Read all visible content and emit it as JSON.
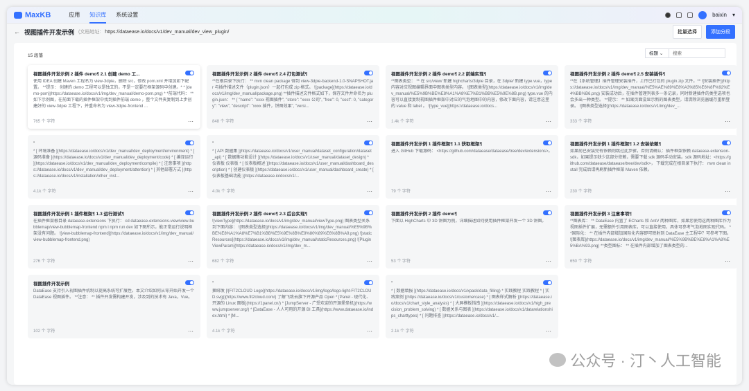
{
  "header": {
    "logo": "MaxKB",
    "nav": [
      "应用",
      "知识库",
      "系统设置"
    ],
    "active_nav": 1,
    "user": "baixin"
  },
  "subheader": {
    "back": "←",
    "title": "视图插件开发示例",
    "doc_label": "(文档地址:",
    "doc_url": "https://dataease.io/docs/v1/dev_manual/dev_view_plugin/",
    "batch_select": "批量选择",
    "add_paragraph": "添加分段"
  },
  "list": {
    "count": "15 段落",
    "filter_select": "标题",
    "search_placeholder": "搜索"
  },
  "cards": [
    {
      "title": "视图插件开发示例 2 插件 demo¶ 2.1 创建 demo 工...",
      "content": "使用 IDEA 创建 Maven 工程名为 view-3dpie，删除 src，修改 pom.xml 并增加如下配置。 **提示： 创建的 demo 工程可以是独立的，不是一定要在框架源码中创建。* * [demo-pom](https://dataease.io/docs/v1/img/dev_manual/demo-pom.png) * *前端代码： ** 如下示例图，在前面下载的插件框架中找到插件前端 demo ，整个文件夹复制到上步创建好的 view-3dpie 工程下，并重命名为 view-3dpie-frontend ...",
      "chars": "765 个 字符",
      "enabled": true
    },
    {
      "title": "视图插件开发示例 2 插件 demo¶ 2.4 打包测试¶",
      "content": "**在根目录下执行： ** mvn clean package 得到 view-3dpie-backend-1.0-SNAPSHOT.jar 与插件描述文件（plugin.json）一起打包成 zip 格式。 ![package](https://dataease.io/docs/v1/img/dev_manual/package.png) **插件描述文件格式如下，保存文件并命名为 plugin.json： ** { \"name\": \"xxxx 视图插件\", \"store\": \"xxxx 公司\", \"free\": 0, \"cost\": 0, \"category\": \"view\", \"descript\": \"xxxx 插件，饼图效果\", \"versi...",
      "chars": "848 个 字符",
      "enabled": true
    },
    {
      "title": "视图插件开发示例 2 插件 demo¶ 2.2 前端实现¶",
      "content": "**图表类型： ** 在 src/view/ 新建 highcharts/3dpie 目录，在 3dpie/ 新建 type.vue，type 内容对应视图编辑界面中图表类型内容。 ![图表类型](https://dataease.io/docs/v1/img/dev_manual/%E5%9B%BE%E8%A1%A8%E7%B1%BB%E5%9E%8B.png) type.vue 的内容可以直接复制视图插件框架中对应的气泡地图中的内容，修改下面内容，请注意这里的 value 和 label 。 ![type_vue](https://dataease.io/docs...",
      "chars": "1.4k 个 字符",
      "enabled": true
    },
    {
      "title": "视图插件开发示例 2 插件 demo¶ 2.5 安装插件¶",
      "content": "**在【系统管理】插件管理安装插件，上传已打包的 plugin.zip 文件。** ![安装插件](https://dataease.io/docs/v1/img/dev_manual/%E5%AE%89%E8%A3%85%E6%8F%92%E4%BB%B6.png) 安装成功后，在插件管理列表多一条记录，同时新建插件的类型选项也会多出一种类型。 **提示： ** 如果页面没显示新的图表类型，请清除浏览器缓存重新登录。 ![图表类型选择](https://dataease.io/docs/v1/img/dev_...",
      "chars": "333 个 字符",
      "enabled": true
    },
    {
      "title": "-",
      "content": "* [ 环境准备 ](https://dataease.io/docs/v1/dev_manual/dev_deployment/environment) * [ 源码准备 ](https://dataease.io/docs/v1/dev_manual/dev_deployment/code) * [ 编译运行 ](https://dataease.io/docs/v1/dev_manual/dev_deployment/compile) * [ 注意事项 ](https://dataease.io/docs/v1/dev_manual/dev_deployment/attention) * [ 其他部署方式 ](https://dataease.io/docs/v1/installation/other_inst...",
      "chars": "4.1k 个 字符",
      "enabled": true
    },
    {
      "title": "-",
      "content": "* [ API 数据集 ](https://dataease.io/docs/v1/user_manual/dataset_configuration/dataset_api) * [ 数据集功能设计 ](https://dataease.io/docs/v1/user_manual/dataset_design) * 仪表板 仪表板 * [ 仪表板概述 ](https://dataease.io/docs/v1/user_manual/dashboard_description) * [ 创建仪表板 ](https://dataease.io/docs/v1/user_manual/dashboard_create) * [ 仪表板基础功能 ](https://dataease.io/docs/v1/...",
      "chars": "4.0k 个 字符",
      "enabled": true
    },
    {
      "title": "视图插件开发示例 1 插件框架¶ 1.1 获取框架¶",
      "content": "进入 GitHub 下载源码： <https://github.com/dataease/dataease/tree/dev/extensions>。",
      "chars": "79 个 字符",
      "enabled": true
    },
    {
      "title": "视图插件开发示例 1 插件框架¶ 1.2 安装依赖¶",
      "content": "如果前已安装完有依赖则跳过此步骤，否则请确认：插件框架依赖 dataease-extension-sdk，如果提示缺少这部分依赖，需要下载 sdk 源码手动安装。sdk 源码地址：<https://github.com/dataease/dataease/tree/dev/sdk>， 下载完成在根目录下执行： mvn clean install 完成后请再刷新插件框架 Maven 依赖。",
      "chars": "230 个 字符",
      "enabled": true
    },
    {
      "title": "视图插件开发示例 1 插件框架¶ 1.3 运行测试¶",
      "content": "在插件框架根目录 dataease-extensions 下执行： cd dataease-extensions-view/view-bubblemap/view-bubblemap-frontend npm i npm run dev 如下图所示，能正常运行说明框架没有问题。 ![view-bubblemap-frontend](https://dataease.io/docs/v1/img/dev_manual/view-bubblemap-frontend.png)",
      "chars": "276 个 字符",
      "enabled": true
    },
    {
      "title": "视图插件开发示例 2 插件 demo¶ 2.3 后台实现¶",
      "content": "![viewType](https://dataease.io/docs/v1/img/dev_manual/viewType.png) 图表类型关系到下面内容： ![图表类型选择](https://dataease.io/docs/v1/img/dev_manual/%E5%9B%BE%E8%A1%A8%E7%B1%BB%E5%9E%8B%E9%80%89%E6%8B%A9.png) ![staticResources](https://dataease.io/docs/v1/img/dev_manual/staticResources.png) ![PluginViewParam](https://dataease.io/docs/v1/img/dev_m...",
      "chars": "682 个 字符",
      "enabled": true
    },
    {
      "title": "视图插件开发示例 2 插件 demo¶",
      "content": "下面以 HighCharts 中 3D 饼图为例，详细描述如何使用插件框架开发一个 3D 饼图。",
      "chars": "53 个 字符",
      "enabled": true
    },
    {
      "title": "视图插件开发示例 3 注意事项¶",
      "content": "**图表库： ** DataEase 内置了 ECharts 和 AntV 两种图库，如果您使用这两种图库作为视图插件扩展，无需额外引用图表库，可以直接使用，具体可参考气泡地图实现代码。 **国际化： ** 在插件内部增加国际化内容即可映射到 DataEase 主工程中？可参考下图。 ![图表库](https://dataease.io/docs/v1/img/dev_manual/%E5%9B%BE%E8%A1%A8%E5%BA%93.png) **类型图标： ** 在插件内部增加了图表类型的...",
      "chars": "650 个 字符",
      "enabled": true
    },
    {
      "title": "视图插件开发示例",
      "content": "DataEase 支持引入视图插件机制以提高系统可扩展性。本文介绍如何从零开始开发一个 DataEase 视图插件。 **注意： ** 插件开发需构建开发，涉及到的技术有 Java，Vue。",
      "chars": "102 个 字符",
      "enabled": true
    },
    {
      "title": "-",
      "content": "捆绑发 [![FIT2CLOUD Logo](https://dataease.io/docs/v1/img/logo/logo-light-FIT2CLOUD.svg)](https://www.fit2cloud.com/) 了解飞致云旗下开源产品 Open * [Panel - 现代化、开源的 Linux 面板](https://1panel.cn/) * [JumpServer - 广受欢迎的开源堡垒机](https://www.jumpserver.org/) * [DataEase - 人人可用的开源 BI 工具](https://www.dataease.io/index.html) * [M...",
      "chars": "4.1k 个 字符",
      "enabled": true
    },
    {
      "title": "-",
      "content": "* [ 数据填报 ](https://dataease.io/docs/v1/xpack/data_filling) * 实践教程 实践教程 * [ 实践案例 ](https://dataease.io/docs/v1/customercase) * [ 图表样式解析 ](https://dataease.io/docs/v1/chart_style_analysis) * [ 大屏模板指南 ](https://dataease.io/docs/v1/high_precision_problem_solving) * [ 数据关系与图表 ](https://dataease.io/docs/v1/datarelationships_charttypes) * [ 问题排查 ](https://dataease.io/docs/v1/...",
      "chars": "2.1k 个 字符",
      "enabled": true
    }
  ],
  "watermark": "公众号 · 汀丶人工智能",
  "colors": {
    "accent": "#3370ff"
  }
}
